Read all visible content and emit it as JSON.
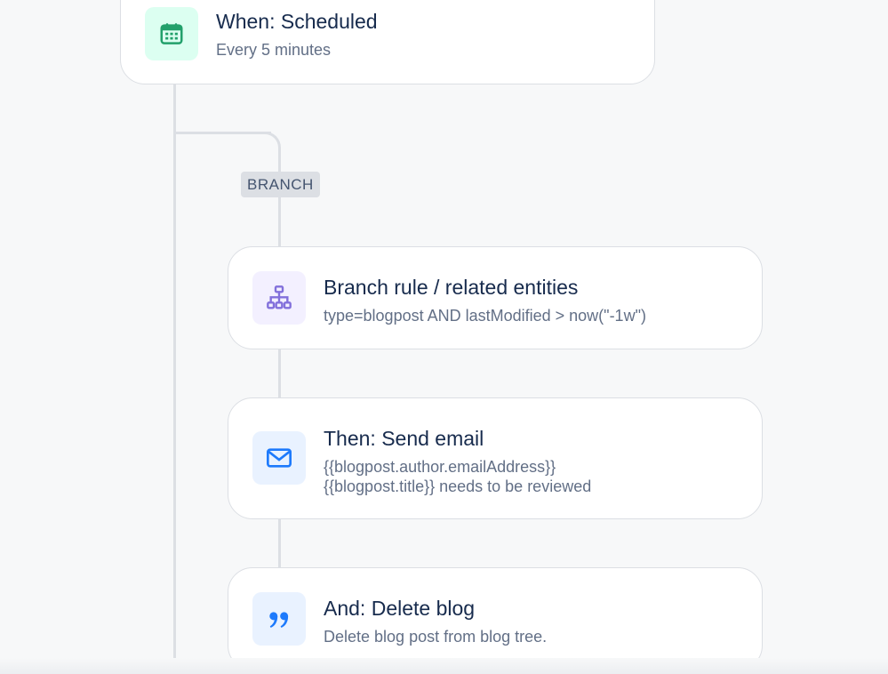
{
  "flow": {
    "branch_tag": "BRANCH",
    "trigger": {
      "title": "When: Scheduled",
      "subtitle": "Every 5 minutes",
      "icon": "calendar-icon",
      "icon_color": "#22a06b"
    },
    "branch_rule": {
      "title": "Branch rule / related entities",
      "subtitle": "type=blogpost AND lastModified > now(\"-1w\")",
      "icon": "hierarchy-icon",
      "icon_color": "#8270db"
    },
    "send_email": {
      "title": "Then: Send email",
      "subtitle_line1": "{{blogpost.author.emailAddress}}",
      "subtitle_line2": "{{blogpost.title}} needs to be reviewed",
      "icon": "envelope-icon",
      "icon_color": "#1d7afc"
    },
    "delete_blog": {
      "title": "And: Delete blog",
      "subtitle": "Delete blog post from blog tree.",
      "icon": "quote-icon",
      "icon_color": "#1d7afc"
    }
  }
}
